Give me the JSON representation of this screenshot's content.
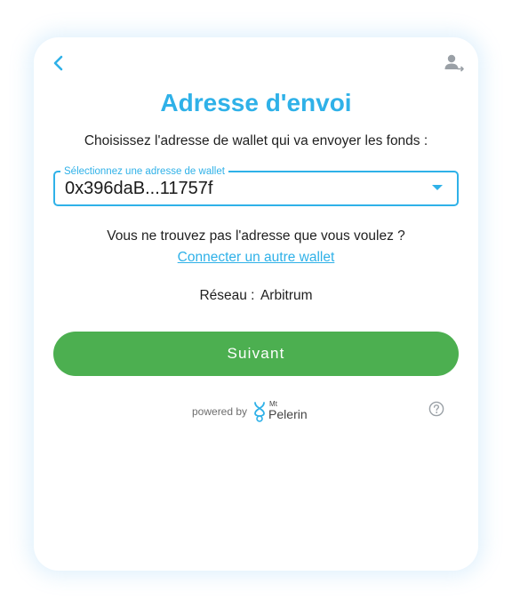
{
  "header": {
    "back_icon": "chevron-left-icon",
    "account_icon": "user-switch-icon"
  },
  "title": "Adresse d'envoi",
  "instruction": "Choisissez l'adresse de wallet qui va envoyer les fonds :",
  "wallet_select": {
    "label": "Sélectionnez une adresse de wallet",
    "value": "0x396daB...11757f"
  },
  "not_found_text": "Vous ne trouvez pas l'adresse que vous voulez ?",
  "connect_link": "Connecter un autre wallet",
  "network": {
    "label": "Réseau :",
    "value": "Arbitrum"
  },
  "submit_button": "Suivant",
  "footer": {
    "powered_by": "powered by",
    "brand_small": "Mt",
    "brand_name": "Pelerin",
    "help_icon": "question-circle-icon"
  },
  "colors": {
    "accent": "#2fb1e8",
    "button": "#4caf50",
    "text": "#1f1f1f"
  }
}
